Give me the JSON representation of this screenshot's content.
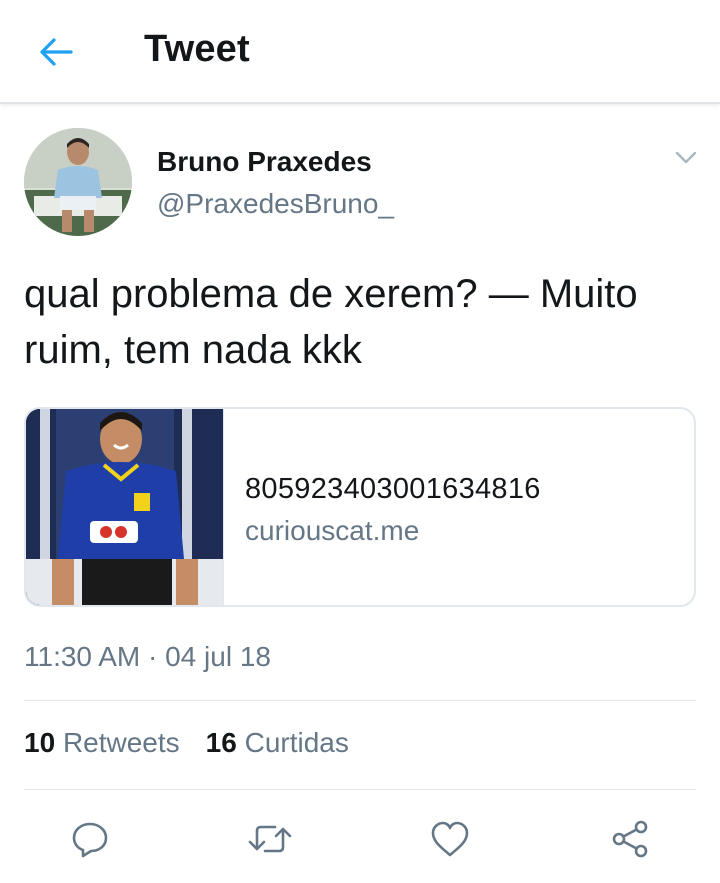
{
  "header": {
    "title": "Tweet",
    "back_icon": "arrow-left-icon"
  },
  "author": {
    "name": "Bruno Praxedes",
    "handle": "@PraxedesBruno_",
    "menu_icon": "chevron-down-icon"
  },
  "tweet": {
    "text": "qual problema de xerem? — Muito ruim, tem nada kkk"
  },
  "card": {
    "title": "805923403001634816",
    "domain": "curiouscat.me"
  },
  "meta": {
    "timestamp": "11:30 AM · 04 jul 18"
  },
  "stats": {
    "retweets_count": "10",
    "retweets_label": "Retweets",
    "likes_count": "16",
    "likes_label": "Curtidas"
  },
  "actions": [
    "reply-icon",
    "retweet-icon",
    "like-icon",
    "share-icon"
  ],
  "colors": {
    "accent": "#1da1f2",
    "text": "#14171a",
    "secondary": "#657786",
    "border": "#e1e8ed"
  }
}
